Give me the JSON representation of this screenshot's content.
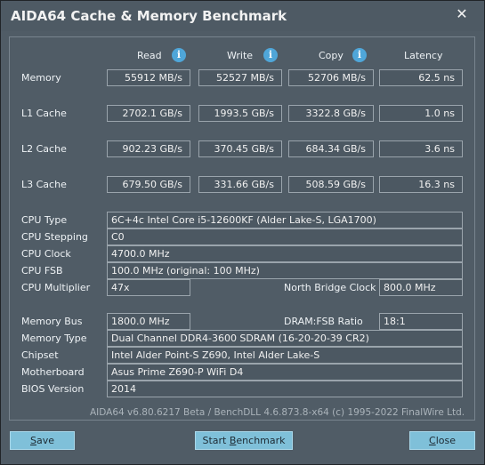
{
  "window": {
    "title": "AIDA64 Cache & Memory Benchmark",
    "close_glyph": "✕"
  },
  "columns": {
    "read": "Read",
    "write": "Write",
    "copy": "Copy",
    "latency": "Latency"
  },
  "benchmark_rows": [
    {
      "label": "Memory",
      "read": "55912 MB/s",
      "write": "52527 MB/s",
      "copy": "52706 MB/s",
      "latency": "62.5 ns"
    },
    {
      "label": "L1 Cache",
      "read": "2702.1 GB/s",
      "write": "1993.5 GB/s",
      "copy": "3322.8 GB/s",
      "latency": "1.0 ns"
    },
    {
      "label": "L2 Cache",
      "read": "902.23 GB/s",
      "write": "370.45 GB/s",
      "copy": "684.34 GB/s",
      "latency": "3.6 ns"
    },
    {
      "label": "L3 Cache",
      "read": "679.50 GB/s",
      "write": "331.66 GB/s",
      "copy": "508.59 GB/s",
      "latency": "16.3 ns"
    }
  ],
  "cpu": {
    "type_label": "CPU Type",
    "type_value": "6C+4c Intel Core i5-12600KF  (Alder Lake-S, LGA1700)",
    "stepping_label": "CPU Stepping",
    "stepping_value": "C0",
    "clock_label": "CPU Clock",
    "clock_value": "4700.0 MHz",
    "fsb_label": "CPU FSB",
    "fsb_value": "100.0 MHz  (original: 100 MHz)",
    "multiplier_label": "CPU Multiplier",
    "multiplier_value": "47x",
    "nb_clock_label": "North Bridge Clock",
    "nb_clock_value": "800.0 MHz"
  },
  "memory": {
    "bus_label": "Memory Bus",
    "bus_value": "1800.0 MHz",
    "ratio_label": "DRAM:FSB Ratio",
    "ratio_value": "18:1",
    "type_label": "Memory Type",
    "type_value": "Dual Channel DDR4-3600 SDRAM  (16-20-20-39 CR2)",
    "chipset_label": "Chipset",
    "chipset_value": "Intel Alder Point-S Z690, Intel Alder Lake-S",
    "motherboard_label": "Motherboard",
    "motherboard_value": "Asus Prime Z690-P WiFi D4",
    "bios_label": "BIOS Version",
    "bios_value": "2014"
  },
  "footer": "AIDA64 v6.80.6217 Beta / BenchDLL 4.6.873.8-x64  (c) 1995-2022 FinalWire Ltd.",
  "buttons": {
    "save_hotkey": "S",
    "save_rest": "ave",
    "start_pre": "Start ",
    "start_hotkey": "B",
    "start_rest": "enchmark",
    "close_hotkey": "C",
    "close_rest": "lose"
  },
  "colors": {
    "window_bg": "#505c66",
    "field_bg": "#4c5862",
    "button_bg": "#7fc0d9",
    "info_icon": "#4fa6d9"
  }
}
